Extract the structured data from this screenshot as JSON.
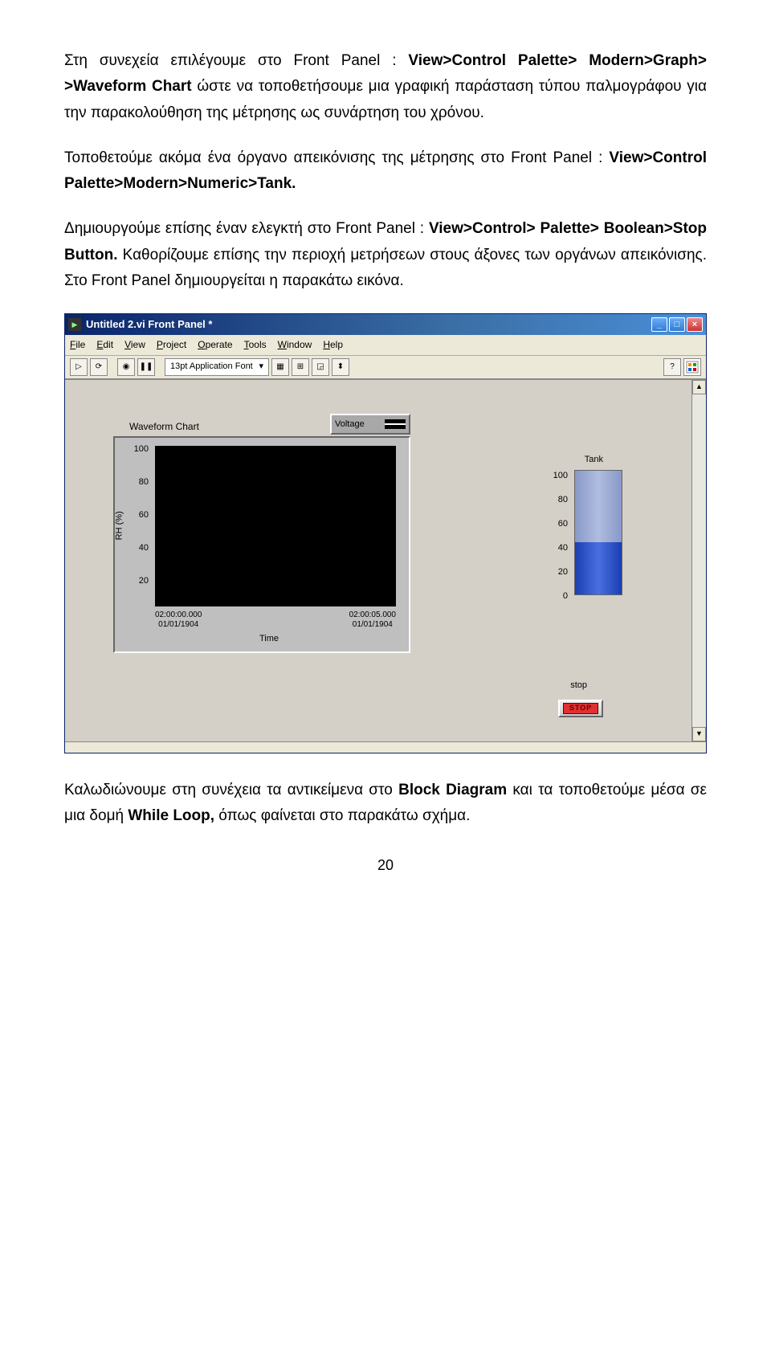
{
  "paragraphs": {
    "p1a": "Στη συνεχεία επιλέγουμε  στο Front Panel : ",
    "p1b": "View>Control Palette> Modern>Graph> >Waveform Chart",
    "p1c": "  ώστε να τοποθετήσουμε μια γραφική παράσταση τύπου παλμογράφου για την παρακολούθηση της μέτρησης ως συνάρτηση του χρόνου.",
    "p2a": "Τοποθετούμε ακόμα ένα όργανο απεικόνισης της μέτρησης στο Front Panel : ",
    "p2b": "View>Control Palette>Modern>Numeric>Tank.",
    "p3a": "Δημιουργούμε επίσης έναν ελεγκτή στο Front Panel : ",
    "p3b": "View>Control> Palette> Boolean>Stop Button.",
    "p3c": " Καθορίζουμε επίσης την περιοχή μετρήσεων στους άξονες των οργάνων απεικόνισης. Στο Front Panel δημιουργείται η παρακάτω εικόνα.",
    "p4a": "Καλωδιώνουμε στη συνέχεια τα αντικείμενα στο ",
    "p4b": "Block Diagram",
    "p4c": " και τα τοποθετούμε μέσα σε μια δομή ",
    "p4d": "While Loop,",
    "p4e": " όπως φαίνεται στο παρακάτω σχήμα."
  },
  "window": {
    "title": "Untitled 2.vi Front Panel *",
    "menu": {
      "file": "File",
      "edit": "Edit",
      "view": "View",
      "project": "Project",
      "operate": "Operate",
      "tools": "Tools",
      "window": "Window",
      "help": "Help"
    },
    "font": "13pt Application Font",
    "chart": {
      "label": "Waveform Chart",
      "legend": "Voltage",
      "ylabel": "RH (%)",
      "xlabel": "Time",
      "yticks": [
        "100",
        "80",
        "60",
        "40",
        "20"
      ],
      "xticks": [
        {
          "t": "02:00:00.000",
          "d": "01/01/1904"
        },
        {
          "t": "02:00:05.000",
          "d": "01/01/1904"
        }
      ]
    },
    "tank": {
      "label": "Tank",
      "ticks": [
        "100",
        "80",
        "60",
        "40",
        "20",
        "0"
      ]
    },
    "stop": {
      "label": "stop",
      "text": "STOP"
    }
  },
  "page_number": "20",
  "chart_data": {
    "type": "line",
    "title": "Waveform Chart",
    "xlabel": "Time",
    "ylabel": "RH (%)",
    "ylim": [
      0,
      100
    ],
    "x_range": [
      "02:00:00.000 01/01/1904",
      "02:00:05.000 01/01/1904"
    ],
    "series": [
      {
        "name": "Voltage",
        "values": []
      }
    ],
    "tank_value_approx": 40
  }
}
